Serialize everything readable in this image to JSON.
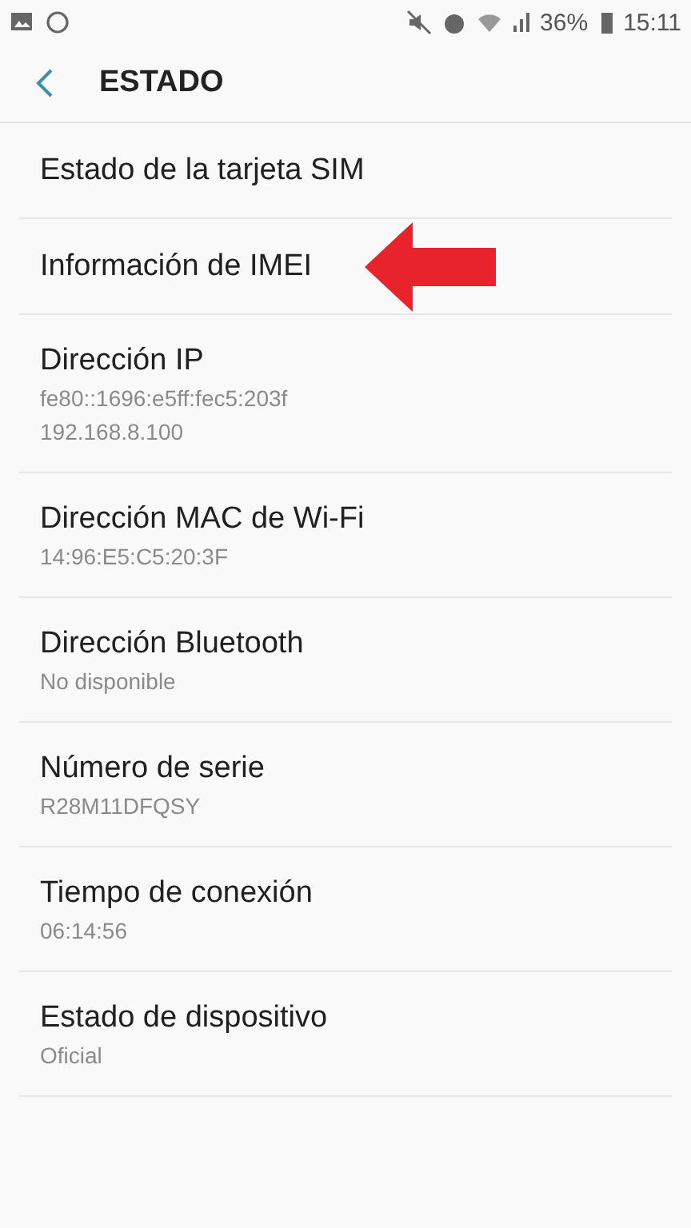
{
  "status_bar": {
    "battery": "36%",
    "time": "15:11"
  },
  "header": {
    "title": "ESTADO"
  },
  "items": [
    {
      "title": "Estado de la tarjeta SIM"
    },
    {
      "title": "Información de IMEI",
      "annotated": true
    },
    {
      "title": "Dirección IP",
      "lines": [
        "fe80::1696:e5ff:fec5:203f",
        "192.168.8.100"
      ]
    },
    {
      "title": "Dirección MAC de Wi-Fi",
      "lines": [
        "14:96:E5:C5:20:3F"
      ]
    },
    {
      "title": "Dirección Bluetooth",
      "lines": [
        "No disponible"
      ]
    },
    {
      "title": "Número de serie",
      "lines": [
        "R28M11DFQSY"
      ]
    },
    {
      "title": "Tiempo de conexión",
      "lines": [
        "06:14:56"
      ]
    },
    {
      "title": "Estado de dispositivo",
      "lines": [
        "Oficial"
      ]
    }
  ]
}
